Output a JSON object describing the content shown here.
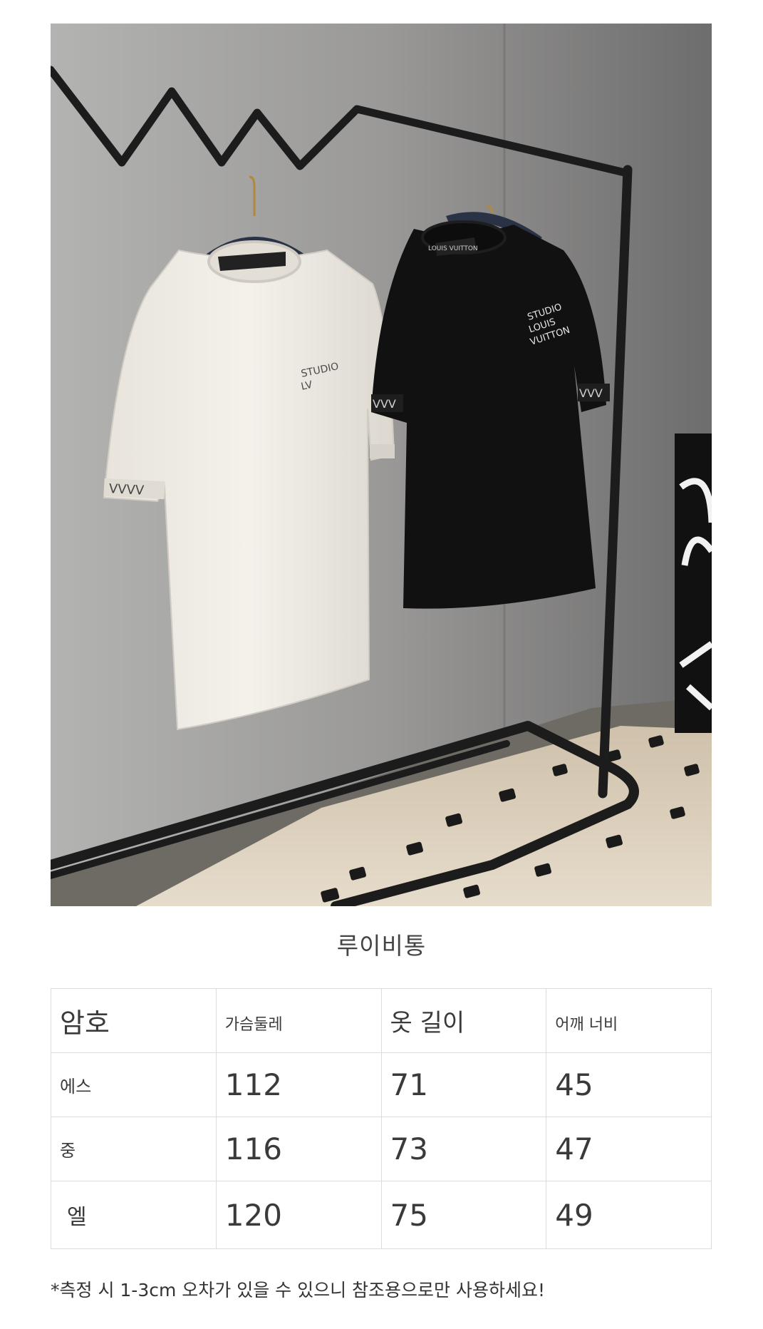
{
  "photo": {
    "alt": "product-photo",
    "left_tag": "LOUIS VUITTON",
    "right_tag": "LOUIS VUITTON",
    "colors": {
      "wall": "#8c8c8c",
      "white_shirt": "#efece6",
      "black_shirt": "#111111",
      "rack": "#1c1c1c",
      "floor": "#d8ccb8"
    }
  },
  "brand": {
    "title": "루이비통"
  },
  "size_table": {
    "headers": [
      "암호",
      "가슴둘레",
      "옷 길이",
      "어깨 너비"
    ],
    "rows": [
      {
        "label": "에스",
        "values": [
          "112",
          "71",
          "45"
        ]
      },
      {
        "label": "중",
        "values": [
          "116",
          "73",
          "47"
        ]
      },
      {
        "label": "엘",
        "values": [
          "120",
          "75",
          "49"
        ]
      }
    ]
  },
  "note": "*측정 시 1-3cm 오차가 있을 수 있으니 참조용으로만 사용하세요!"
}
